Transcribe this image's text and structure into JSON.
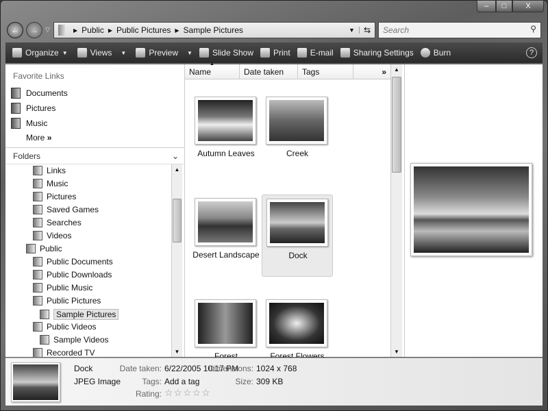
{
  "window": {
    "minimize": "–",
    "maximize": "□",
    "close": "X"
  },
  "address": {
    "segments": [
      "Public",
      "Public Pictures",
      "Sample Pictures"
    ],
    "search_placeholder": "Search"
  },
  "toolbar": {
    "items": [
      "Organize",
      "Views",
      "Preview",
      "Slide Show",
      "Print",
      "E-mail",
      "Sharing Settings",
      "Burn"
    ],
    "help": "?"
  },
  "favorites": {
    "header": "Favorite Links",
    "items": [
      "Documents",
      "Pictures",
      "Music"
    ],
    "more": "More"
  },
  "folders": {
    "header": "Folders",
    "items": [
      {
        "label": "Links",
        "level": 1
      },
      {
        "label": "Music",
        "level": 1
      },
      {
        "label": "Pictures",
        "level": 1
      },
      {
        "label": "Saved Games",
        "level": 1
      },
      {
        "label": "Searches",
        "level": 1
      },
      {
        "label": "Videos",
        "level": 1
      },
      {
        "label": "Public",
        "level": 0
      },
      {
        "label": "Public Documents",
        "level": 1
      },
      {
        "label": "Public Downloads",
        "level": 1
      },
      {
        "label": "Public Music",
        "level": 1
      },
      {
        "label": "Public Pictures",
        "level": 1
      },
      {
        "label": "Sample Pictures",
        "level": 2,
        "selected": true
      },
      {
        "label": "Public Videos",
        "level": 1
      },
      {
        "label": "Sample Videos",
        "level": 2
      },
      {
        "label": "Recorded TV",
        "level": 1
      }
    ]
  },
  "columns": [
    "Name",
    "Date taken",
    "Tags"
  ],
  "more_columns": "»",
  "files": [
    {
      "name": "Autumn Leaves"
    },
    {
      "name": "Creek"
    },
    {
      "name": "Desert Landscape"
    },
    {
      "name": "Dock",
      "selected": true
    },
    {
      "name": "Forest"
    },
    {
      "name": "Forest Flowers"
    }
  ],
  "details": {
    "name": "Dock",
    "type": "JPEG Image",
    "date_label": "Date taken:",
    "date": "6/22/2005 10:17 PM",
    "tags_label": "Tags:",
    "tags": "Add a tag",
    "rating_label": "Rating:",
    "rating": 0,
    "dim_label": "Dimensions:",
    "dim": "1024 x 768",
    "size_label": "Size:",
    "size": "309 KB"
  }
}
